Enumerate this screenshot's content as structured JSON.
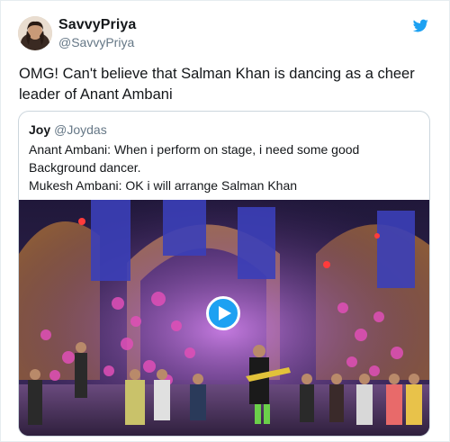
{
  "user": {
    "display_name": "SavvyPriya",
    "handle": "@SavvyPriya"
  },
  "tweet": {
    "text_line1": "OMG! Can't believe that Salman Khan is dancing as a cheer",
    "text_line2": "leader of Anant Ambani"
  },
  "quoted_tweet": {
    "name": "Joy",
    "handle": "@Joydas",
    "lines": [
      "Anant Ambani: When i perform on stage, i need some good",
      "Background dancer.",
      "Mukesh Ambani: OK i will arrange Salman Khan"
    ]
  },
  "icons": {
    "brand": "twitter-bird-icon",
    "video": "play-icon"
  },
  "colors": {
    "brand": "#1da1f2",
    "text": "#14171a",
    "secondary_text": "#657786",
    "border": "#ccd6dd"
  }
}
